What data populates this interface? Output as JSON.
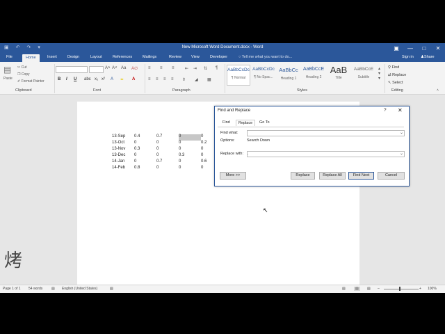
{
  "window": {
    "title": "New Microsoft Word Document.docx - Word",
    "qat_icons": [
      "save-icon",
      "undo-icon",
      "redo-icon",
      "customize-icon"
    ],
    "controls": {
      "ribbon_display": "▣",
      "minimize": "—",
      "maximize": "□",
      "close": "✕"
    }
  },
  "ribbon_tabs": [
    "File",
    "Home",
    "Insert",
    "Design",
    "Layout",
    "References",
    "Mailings",
    "Review",
    "View",
    "Developer"
  ],
  "tell_me": "Tell me what you want to do...",
  "account": {
    "sign_in": "Sign in",
    "share": "Share"
  },
  "clipboard": {
    "paste": "Paste",
    "cut": "Cut",
    "copy": "Copy",
    "format_painter": "Format Painter",
    "label": "Clipboard"
  },
  "font": {
    "name": "",
    "size": "",
    "label": "Font",
    "bold": "B",
    "italic": "I",
    "underline": "U"
  },
  "paragraph": {
    "label": "Paragraph"
  },
  "styles": {
    "label": "Styles",
    "items": [
      {
        "preview": "AaBbCcDc",
        "name": "¶ Normal"
      },
      {
        "preview": "AaBbCcDc",
        "name": "¶ No Spac..."
      },
      {
        "preview": "AaBbCc",
        "name": "Heading 1"
      },
      {
        "preview": "AaBbCcE",
        "name": "Heading 2"
      },
      {
        "preview": "AaB",
        "name": "Title"
      },
      {
        "preview": "AaBbCcE",
        "name": "Subtitle"
      }
    ]
  },
  "editing": {
    "find": "Find",
    "replace": "Replace",
    "select": "Select",
    "label": "Editing"
  },
  "table": {
    "rows": [
      [
        "13-Sep",
        "0.4",
        "0.7",
        "0",
        "0"
      ],
      [
        "13-Oct",
        "0",
        "0",
        "0",
        "0.2"
      ],
      [
        "13-Nov",
        "0.3",
        "0",
        "0",
        "0"
      ],
      [
        "13-Dec",
        "0",
        "0",
        "0.3",
        "0"
      ],
      [
        "14-Jan",
        "0",
        "0.7",
        "0",
        "0.6"
      ],
      [
        "14-Feb",
        "0.8",
        "0",
        "0",
        "0"
      ]
    ]
  },
  "dialog": {
    "title": "Find and Replace",
    "help": "?",
    "close": "✕",
    "tabs": [
      "Find",
      "Replace",
      "Go To"
    ],
    "find_label": "Find what:",
    "find_value": "",
    "options_label": "Options:",
    "options_value": "Search Down",
    "replace_label": "Replace with:",
    "replace_value": ".",
    "buttons": {
      "more": "More >>",
      "replace": "Replace",
      "replace_all": "Replace All",
      "find_next": "Find Next",
      "cancel": "Cancel"
    }
  },
  "status": {
    "page": "Page 1 of 1",
    "words": "54 words",
    "language": "English (United States)",
    "zoom": "100%"
  }
}
